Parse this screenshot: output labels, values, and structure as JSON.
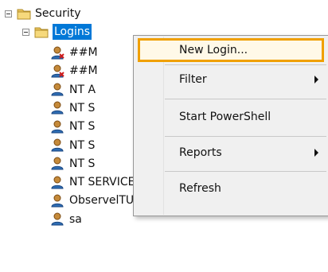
{
  "tree": {
    "security_label": "Security",
    "logins_label": "Logins",
    "items": [
      {
        "label": "##M",
        "icon": "login-disabled-icon"
      },
      {
        "label": "##M",
        "icon": "login-disabled-icon"
      },
      {
        "label": "NT A",
        "icon": "login-user-icon"
      },
      {
        "label": "NT S",
        "icon": "login-user-icon"
      },
      {
        "label": "NT S",
        "icon": "login-user-icon"
      },
      {
        "label": "NT S",
        "icon": "login-user-icon"
      },
      {
        "label": "NT S",
        "icon": "login-user-icon"
      },
      {
        "label": "NT SERVICE\\Winmgmt",
        "icon": "login-user-icon"
      },
      {
        "label": "ObservelTUser",
        "icon": "login-user-icon"
      },
      {
        "label": "sa",
        "icon": "login-user-icon"
      }
    ]
  },
  "context_menu": {
    "items": [
      {
        "label": "New Login...",
        "highlighted": true
      },
      {
        "label": "Filter",
        "submenu": true
      },
      {
        "label": "Start PowerShell"
      },
      {
        "label": "Reports",
        "submenu": true
      },
      {
        "label": "Refresh"
      }
    ]
  },
  "colors": {
    "highlight_border": "#f0a000",
    "selection": "#0078d7",
    "menu_bg": "#f0f0f0"
  }
}
